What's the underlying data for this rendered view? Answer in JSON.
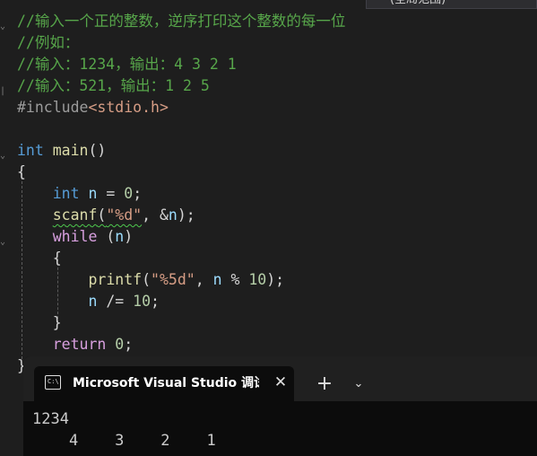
{
  "scope_dropdown": {
    "value": "(全局范围)"
  },
  "code_lines": [
    [
      {
        "t": "//输入一个正的整数，逆序打印这个整数的每一位",
        "c": "cmt"
      }
    ],
    [
      {
        "t": "//例如：",
        "c": "cmt"
      }
    ],
    [
      {
        "t": "//输入：1234，输出：4 3 2 1",
        "c": "cmt"
      }
    ],
    [
      {
        "t": "//输入：521，输出：1 2 5",
        "c": "cmt"
      }
    ],
    [
      {
        "t": "#include",
        "c": "pre"
      },
      {
        "t": "<stdio.h>",
        "c": "inc"
      }
    ],
    [],
    [
      {
        "t": "int",
        "c": "kw"
      },
      {
        "t": " "
      },
      {
        "t": "main",
        "c": "fn"
      },
      {
        "t": "()",
        "c": "punc"
      }
    ],
    [
      {
        "t": "{",
        "c": "brace"
      }
    ],
    [
      {
        "t": "    "
      },
      {
        "t": "int",
        "c": "kw"
      },
      {
        "t": " "
      },
      {
        "t": "n",
        "c": "var"
      },
      {
        "t": " = "
      },
      {
        "t": "0",
        "c": "num"
      },
      {
        "t": ";"
      }
    ],
    [
      {
        "t": "    "
      },
      {
        "t": "scanf",
        "c": "fn squiggle"
      },
      {
        "t": "(",
        "c": "punc squiggle"
      },
      {
        "t": "\"%d\"",
        "c": "str squiggle"
      },
      {
        "t": ", "
      },
      {
        "t": "&",
        "c": "punc"
      },
      {
        "t": "n",
        "c": "var"
      },
      {
        "t": ");"
      }
    ],
    [
      {
        "t": "    "
      },
      {
        "t": "while",
        "c": "ctl"
      },
      {
        "t": " ("
      },
      {
        "t": "n",
        "c": "var"
      },
      {
        "t": ")"
      }
    ],
    [
      {
        "t": "    "
      },
      {
        "t": "{",
        "c": "brace"
      }
    ],
    [
      {
        "t": "        "
      },
      {
        "t": "printf",
        "c": "fn"
      },
      {
        "t": "("
      },
      {
        "t": "\"%5d\"",
        "c": "str"
      },
      {
        "t": ", "
      },
      {
        "t": "n",
        "c": "var"
      },
      {
        "t": " % "
      },
      {
        "t": "10",
        "c": "num"
      },
      {
        "t": ");"
      }
    ],
    [
      {
        "t": "        "
      },
      {
        "t": "n",
        "c": "var"
      },
      {
        "t": " /= "
      },
      {
        "t": "10",
        "c": "num"
      },
      {
        "t": ";"
      }
    ],
    [
      {
        "t": "    "
      },
      {
        "t": "}",
        "c": "brace"
      }
    ],
    [
      {
        "t": "    "
      },
      {
        "t": "return",
        "c": "ctl"
      },
      {
        "t": " "
      },
      {
        "t": "0",
        "c": "num"
      },
      {
        "t": ";"
      }
    ],
    [
      {
        "t": "}",
        "c": "brace"
      }
    ]
  ],
  "terminal": {
    "tab_title": "Microsoft Visual Studio 调试控制台",
    "tab_icon_text": "C:\\",
    "close_glyph": "✕",
    "add_glyph": "+",
    "dropdown_glyph": "⌄",
    "output": [
      "1234",
      "    4    3    2    1"
    ]
  }
}
